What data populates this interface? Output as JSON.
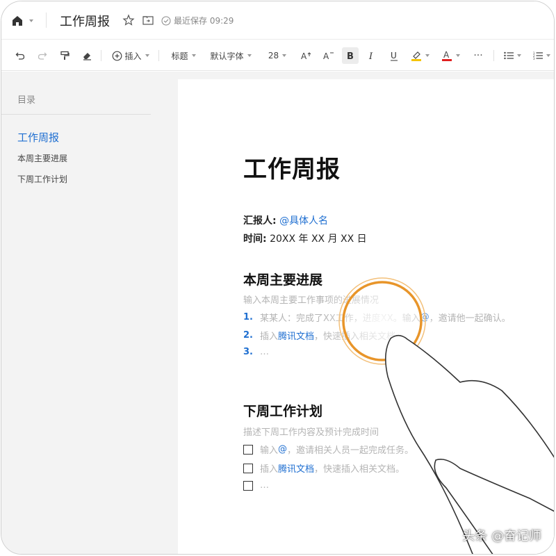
{
  "titlebar": {
    "doc_title": "工作周报",
    "save_status": "最近保存 09:29",
    "icons": [
      "home-icon",
      "star-icon",
      "folder-move-icon",
      "check-circle-icon"
    ]
  },
  "toolbar": {
    "insert_label": "插入",
    "style_label": "标题",
    "font_label": "默认字体",
    "size_label": "28",
    "more_label": "···"
  },
  "sidebar": {
    "outline_title": "目录",
    "items": [
      {
        "label": "工作周报",
        "level": 1
      },
      {
        "label": "本周主要进展",
        "level": 2
      },
      {
        "label": "下周工作计划",
        "level": 2
      }
    ]
  },
  "document": {
    "title": "工作周报",
    "reporter_label": "汇报人:",
    "reporter_value": "@具体人名",
    "time_label": "时间:",
    "time_value": "20XX 年 XX 月 XX 日",
    "section1": {
      "heading": "本周主要进展",
      "hint": "输入本周主要工作事项的进展情况",
      "items": [
        {
          "num": "1.",
          "text_a": "某某人：完成了XX工作，进度XX。输入",
          "mention": "@",
          "text_b": "，邀请他一起确认。"
        },
        {
          "num": "2.",
          "text_a": "插入",
          "mention": "腾讯文档",
          "text_b": "，快速插入相关文档。"
        },
        {
          "num": "3.",
          "text_a": "…",
          "mention": "",
          "text_b": ""
        }
      ]
    },
    "section2": {
      "heading": "下周工作计划",
      "hint": "描述下周工作内容及预计完成时间",
      "items": [
        {
          "text_a": "输入",
          "mention": "@",
          "text_b": "，邀请相关人员一起完成任务。"
        },
        {
          "text_a": "插入",
          "mention": "腾讯文档",
          "text_b": "，快速插入相关文档。"
        },
        {
          "text_a": "…",
          "mention": "",
          "text_b": ""
        }
      ]
    }
  },
  "watermark": "头条 @奋记师",
  "colors": {
    "accent": "#1f6fd1",
    "touch_ring": "#e8952a",
    "sidebar_bg": "#f3f3f3"
  }
}
